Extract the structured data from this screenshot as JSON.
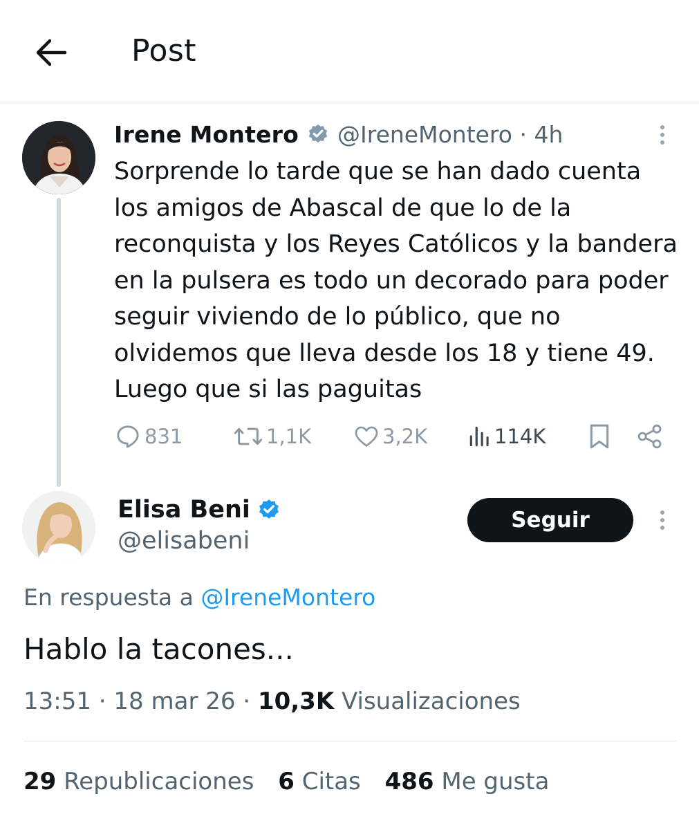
{
  "header": {
    "title": "Post"
  },
  "parent_post": {
    "author_name": "Irene Montero",
    "handle": "@IreneMontero",
    "separator": " · ",
    "time": "4h",
    "text": "Sorprende lo tarde que se han dado cuenta los amigos de Abascal de que lo de la reconquista y los Reyes Católicos y la bandera en la pulsera es todo un decorado para poder seguir viviendo de lo público, que no olvidemos que lleva desde los 18 y tiene 49. Luego que si las paguitas",
    "verified_badge_color": "#829aab",
    "actions": {
      "replies": "831",
      "reposts": "1,1K",
      "likes": "3,2K",
      "views": "114K"
    }
  },
  "reply_post": {
    "author_name": "Elisa Beni",
    "handle": "@elisabeni",
    "verified_badge_color": "#1d9bf0",
    "follow_label": "Seguir",
    "reply_to_prefix": "En respuesta a ",
    "reply_to_mention": "@IreneMontero",
    "text": "Hablo la tacones...",
    "time": "13:51",
    "date": "18 mar 26",
    "meta_sep": " · ",
    "views_count": "10,3K",
    "views_label": " Visualizaciones"
  },
  "stats": {
    "reposts_count": "29",
    "reposts_label": " Republicaciones",
    "quotes_count": "6",
    "quotes_label": " Citas",
    "likes_count": "486",
    "likes_label": " Me gusta"
  },
  "colors": {
    "text_primary": "#0f1419",
    "text_secondary": "#536471",
    "accent": "#1d9bf0",
    "follow_button": "#0f1419"
  },
  "icons": [
    "back-arrow-icon",
    "verified-badge-icon",
    "more-icon",
    "reply-icon",
    "repost-icon",
    "like-icon",
    "views-icon",
    "bookmark-icon",
    "share-icon"
  ]
}
